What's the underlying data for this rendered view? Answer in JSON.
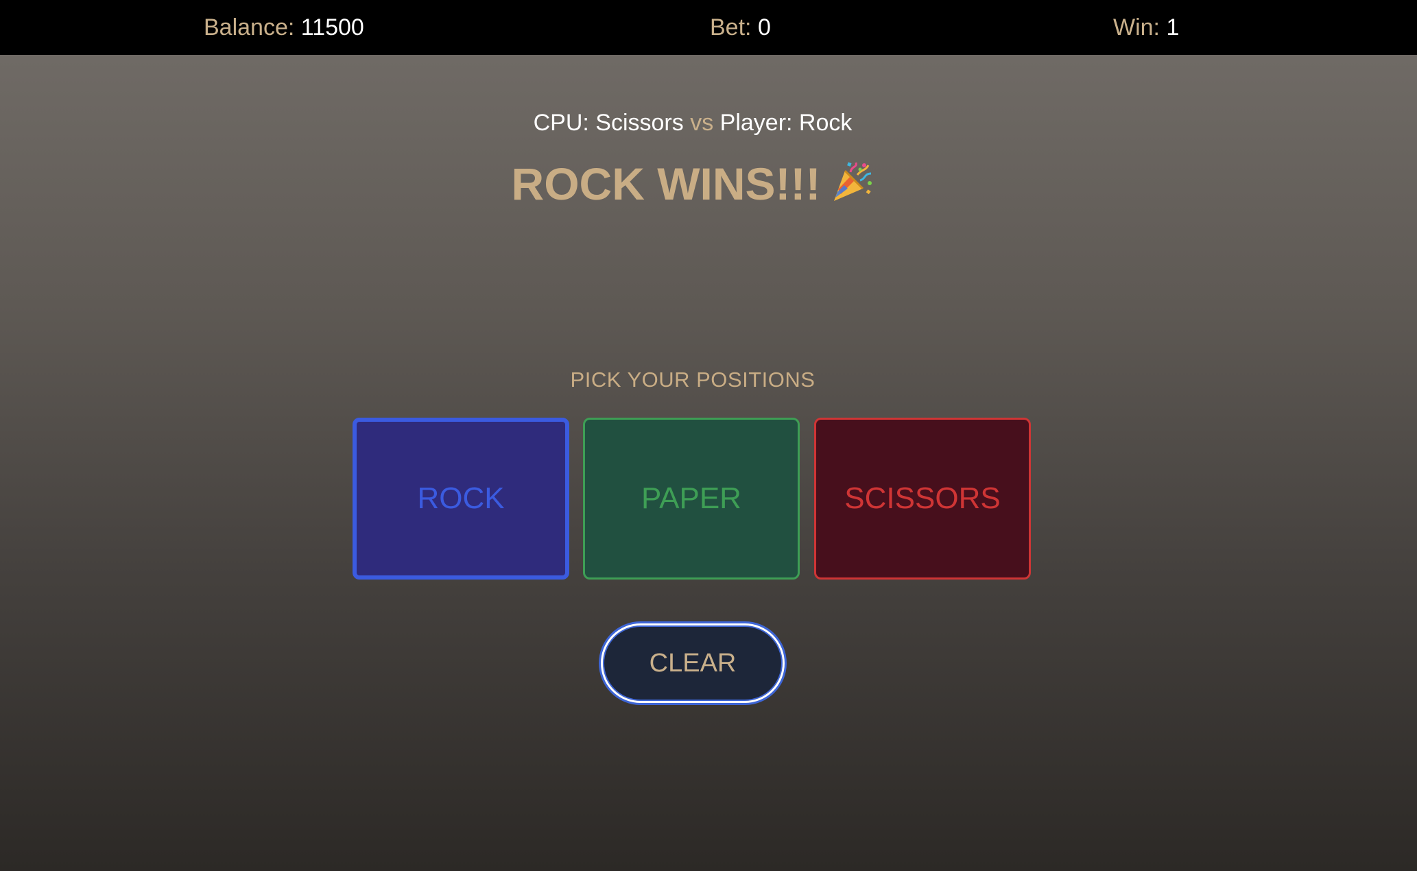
{
  "header": {
    "balance_label": "Balance:",
    "balance_value": "11500",
    "bet_label": "Bet:",
    "bet_value": "0",
    "win_label": "Win:",
    "win_value": "1"
  },
  "game": {
    "cpu_text": "CPU: Scissors",
    "vs_text": "vs",
    "player_text": "Player: Rock",
    "result_text": "ROCK WINS!!!",
    "result_icon": "party-popper-icon",
    "pick_title": "PICK YOUR POSITIONS",
    "choices": [
      {
        "label": "ROCK",
        "selected": true,
        "color": "#3b5be0",
        "background": "#2f2b7c"
      },
      {
        "label": "PAPER",
        "selected": false,
        "color": "#3e9e55",
        "background": "#215040"
      },
      {
        "label": "SCISSORS",
        "selected": false,
        "color": "#cf3535",
        "background": "#470f1c"
      }
    ],
    "clear_label": "CLEAR"
  },
  "colors": {
    "accent_gold": "#c9ad85",
    "top_bar": "#000000",
    "clear_button_bg": "#1d2639",
    "clear_button_ring": "#3d65d6"
  }
}
